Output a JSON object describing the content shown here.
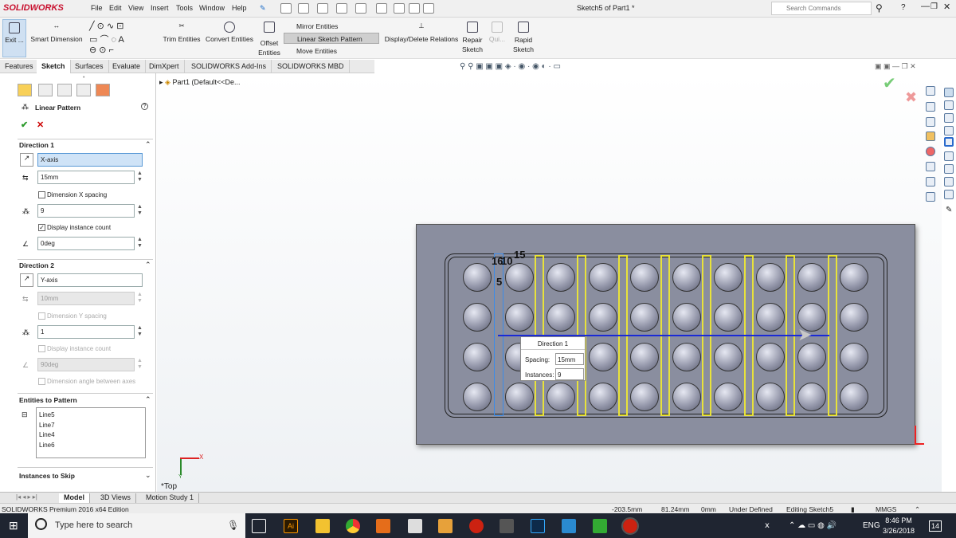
{
  "app": {
    "logo": "SOLIDWORKS",
    "title": "Sketch5 of Part1 *",
    "search_placeholder": "Search Commands"
  },
  "menu": [
    "File",
    "Edit",
    "View",
    "Insert",
    "Tools",
    "Window",
    "Help"
  ],
  "ribbon": {
    "exit": "Exit ...",
    "smart_dimension": "Smart Dimension",
    "trim": "Trim Entities",
    "convert": "Convert Entities",
    "offset": "Offset Entities",
    "mirror": "Mirror Entities",
    "linear_pattern": "Linear Sketch Pattern",
    "move": "Move Entities",
    "display_delete": "Display/Delete Relations",
    "repair": "Repair Sketch",
    "quick": "Qui...",
    "rapid": "Rapid Sketch"
  },
  "tabs": [
    "Features",
    "Sketch",
    "Surfaces",
    "Evaluate",
    "DimXpert",
    "SOLIDWORKS Add-Ins",
    "SOLIDWORKS MBD"
  ],
  "active_tab": "Sketch",
  "tree": {
    "part": "Part1  (Default<<De..."
  },
  "pm": {
    "title": "Linear Pattern",
    "dir1": {
      "header": "Direction 1",
      "axis": "X-axis",
      "spacing": "15mm",
      "dim_spacing": "Dimension X spacing",
      "count": "9",
      "display_count": "Display instance count",
      "angle": "0deg"
    },
    "dir2": {
      "header": "Direction 2",
      "axis": "Y-axis",
      "spacing": "10mm",
      "dim_spacing": "Dimension Y spacing",
      "count": "1",
      "display_count": "Display instance count",
      "angle": "90deg",
      "dim_angle": "Dimension angle between axes"
    },
    "entities": {
      "header": "Entities to Pattern",
      "items": [
        "Line5",
        "Line7",
        "Line4",
        "Line6"
      ]
    },
    "skip": "Instances to Skip"
  },
  "canvas": {
    "dims": {
      "a": "15",
      "b": "10",
      "c": "16",
      "d": "5"
    },
    "callout": {
      "title": "Direction 1",
      "spacing_label": "Spacing:",
      "spacing": "15mm",
      "instances_label": "Instances:",
      "instances": "9"
    },
    "view_label": "*Top",
    "axis_x": "X",
    "axis_y": "Y"
  },
  "bottom_tabs": [
    "Model",
    "3D Views",
    "Motion Study 1"
  ],
  "status": {
    "edition": "SOLIDWORKS Premium 2016 x64 Edition",
    "x": "-203.5mm",
    "y": "81.24mm",
    "z": "0mm",
    "defined": "Under Defined",
    "editing": "Editing Sketch5",
    "units": "MMGS"
  },
  "taskbar": {
    "search": "Type here to search",
    "time": "8:46 PM",
    "date": "3/26/2018",
    "lang": "ENG",
    "notif": "14"
  },
  "colors": {
    "accent": "#c8102e",
    "pattern_lines": "#e8e23a",
    "plate": "#8a8e9f",
    "direction": "#1a2ad6"
  }
}
